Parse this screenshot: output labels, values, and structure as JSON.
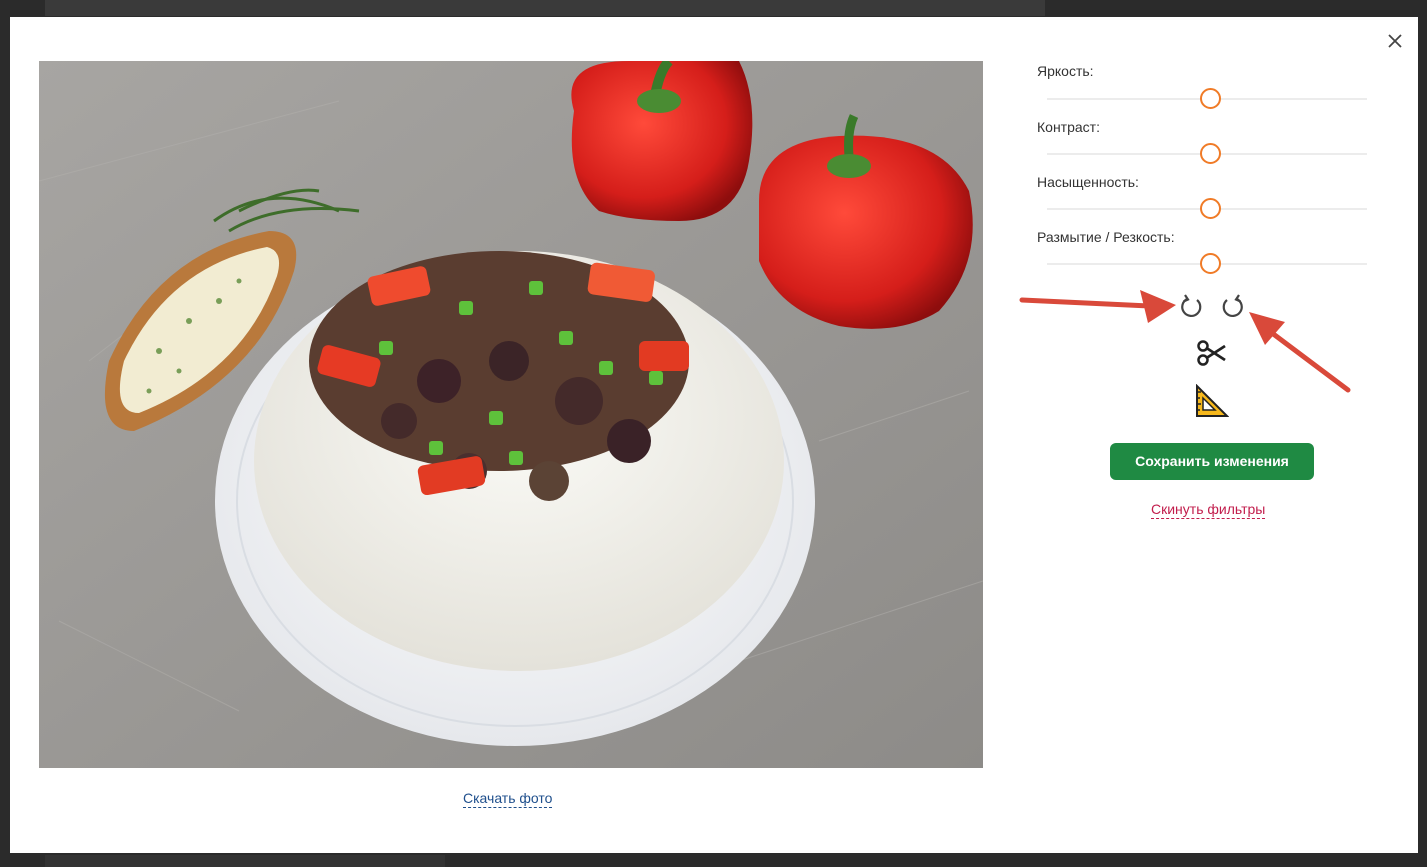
{
  "editor": {
    "sliders": [
      {
        "label": "Яркость:",
        "value": 0.5
      },
      {
        "label": "Контраст:",
        "value": 0.5
      },
      {
        "label": "Насыщенность:",
        "value": 0.5
      },
      {
        "label": "Размытие / Резкость:",
        "value": 0.5
      }
    ],
    "tools": {
      "rotate_cw_icon": "rotate-clockwise-icon",
      "rotate_ccw_icon": "rotate-counterclockwise-icon",
      "crop_icon": "scissors-icon",
      "resize_icon": "set-square-icon"
    },
    "save_label": "Сохранить изменения",
    "reset_label": "Скинуть фильтры"
  },
  "photo": {
    "download_label": "Скачать фото"
  },
  "colors": {
    "accent_orange": "#f07b27",
    "save_green": "#1f8a43",
    "reset_red": "#c21d4c",
    "link_blue": "#1f4f8c",
    "annotation_arrow": "#d9493a"
  }
}
